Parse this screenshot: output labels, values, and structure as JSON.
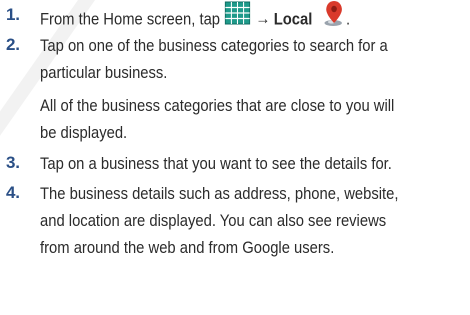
{
  "steps": [
    {
      "number": "1.",
      "before_icon": "From the Home screen, tap ",
      "icon_1": "apps-grid-icon",
      "arrow": "→",
      "local_label": "Local",
      "icon_2": "local-map-pin-icon",
      "after": "."
    },
    {
      "number": "2.",
      "lines": [
        "Tap on one of the business categories to search for a",
        "particular business."
      ],
      "note_lines": [
        "All of the business categories that are close to you will",
        "be displayed."
      ]
    },
    {
      "number": "3.",
      "lines": [
        "Tap on a business that you want to see the details for."
      ]
    },
    {
      "number": "4.",
      "lines": [
        "The business details such as address, phone, website,",
        "and location are displayed. You can also see reviews",
        "from around the web and from Google users."
      ]
    }
  ],
  "colors": {
    "step_number": "#2a4f86",
    "icon_grid": "#1e9a8a",
    "pin_red": "#d93a2b"
  }
}
